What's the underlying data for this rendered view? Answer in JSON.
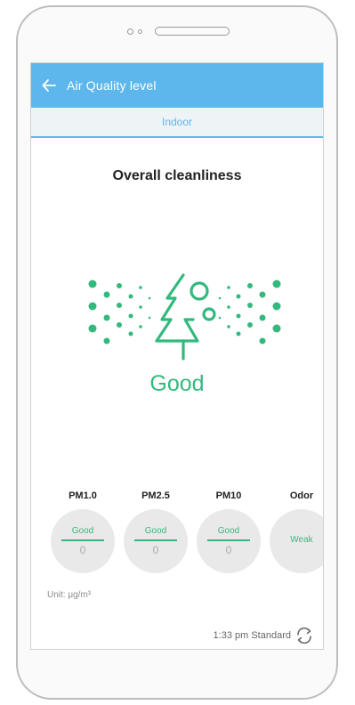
{
  "appbar": {
    "title": "Air Quality level"
  },
  "tabs": [
    {
      "label": "Indoor"
    }
  ],
  "overall": {
    "title": "Overall cleanliness",
    "status": "Good"
  },
  "metrics": [
    {
      "label": "PM1.0",
      "quality": "Good",
      "value": "0"
    },
    {
      "label": "PM2.5",
      "quality": "Good",
      "value": "0"
    },
    {
      "label": "PM10",
      "quality": "Good",
      "value": "0"
    },
    {
      "label": "Odor",
      "quality": "Weak",
      "value": ""
    }
  ],
  "unit": "Unit: μg/m³",
  "footer": {
    "timestamp": "1:33 pm Standard"
  },
  "icons": {
    "back": "arrow-left-icon",
    "tree": "tree-icon",
    "refresh": "refresh-icon"
  },
  "colors": {
    "appbar": "#5eb7ec",
    "good": "#33b97e",
    "circle": "#e9e9e9"
  }
}
